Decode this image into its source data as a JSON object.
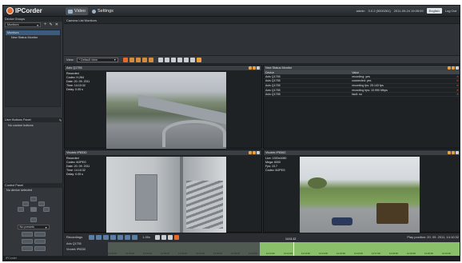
{
  "app": {
    "logo": "IPCorder",
    "nav_video": "Video",
    "nav_settings": "Settings",
    "user": "admin",
    "version": "3.0.2 (5000261)",
    "datetime": "2011-09-24 19:05:09",
    "language": "English",
    "logout": "Log Out"
  },
  "left": {
    "device_groups_title": "Device Groups",
    "group_select": "Monitors",
    "tree": [
      "Monitors",
      "New Status Monitor"
    ],
    "user_buttons_title": "User Buttons Panel",
    "user_buttons_empty": "No custom buttons",
    "control_panel_title": "Control Panel",
    "control_device": "No device selected",
    "presets": "No presets"
  },
  "main": {
    "camera_list_tab": "Camera List Monitors",
    "view_label": "View",
    "view_select": "* Default view"
  },
  "panes": {
    "cam1": {
      "title": "Axis Q1755",
      "lines": [
        "Recorded",
        "Codec: H.264",
        "Date: 20. 09. 2011",
        "Time: 14:10:32",
        "Delay: 0.05 s"
      ]
    },
    "cam2": {
      "title": "Vivotek IP8330",
      "lines": [
        "Recorded",
        "Codec: MJPEG",
        "Date: 20. 09. 2011",
        "Time: 14:10:32",
        "Delay: 0.05 s"
      ]
    },
    "cam3": {
      "title": "Vivotek IP8362",
      "lines": [
        "Live: 1920x1080",
        "Mega: 6000",
        "Fps: 13.7",
        "Codec: MJPEG"
      ]
    },
    "status": {
      "title": "New Status Monitor",
      "columns": [
        "Device",
        "Value"
      ],
      "rows": [
        [
          "Axis Q1755",
          "recording: yes"
        ],
        [
          "Axis Q1755",
          "connected: yes"
        ],
        [
          "Axis Q1755",
          "recording fps: 25.143 fps"
        ],
        [
          "Axis Q1755",
          "recording bps: 10.990 Mbps"
        ],
        [
          "Axis Q1755",
          "fault: no"
        ]
      ]
    }
  },
  "recordings": {
    "label": "Recordings",
    "speed": "1.00x",
    "play_position": "Play position: 20. 09. 2011, 14:10:32",
    "cursor_label": "14:11:12",
    "devices": [
      "Axis Q1755",
      "Vivotek IP8330"
    ],
    "ticks": [
      "14:02:00",
      "14:03:00",
      "14:04:00",
      "14:05:00",
      "14:06:00",
      "14:07:00",
      "14:08:00",
      "14:09:00",
      "14:10:00",
      "14:11:00",
      "14:12:00",
      "14:13:00",
      "14:14:00",
      "14:15:00",
      "14:16:00",
      "14:17:00",
      "14:18:00",
      "14:19:00",
      "14:20:00",
      "14:21:00"
    ]
  },
  "statusbar": "IPCorder"
}
